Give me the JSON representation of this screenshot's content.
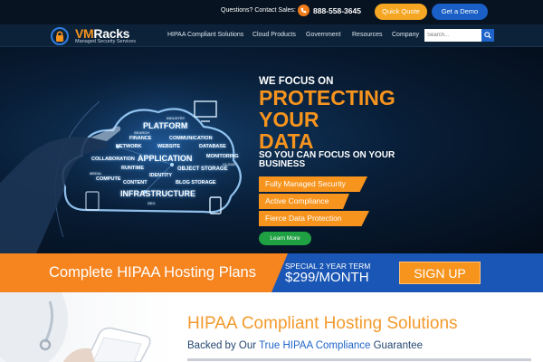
{
  "topbar": {
    "contact_label": "Questions? Contact Sales:",
    "phone": "888-558-3645",
    "quote_button": "Quick Quote",
    "demo_button": "Get a Demo"
  },
  "nav": {
    "logo_brand_vm": "VM",
    "logo_brand_racks": "Racks",
    "logo_tagline": "Managed Security Services",
    "items": [
      "HIPAA Compliant Solutions",
      "Cloud Products",
      "Government",
      "Resources",
      "Company"
    ],
    "search_placeholder": "Search..."
  },
  "hero": {
    "pre_title": "WE FOCUS ON",
    "headline_lines": [
      "PROTECTING",
      "YOUR",
      "DATA"
    ],
    "subtitle": "SO YOU CAN FOCUS ON YOUR BUSINESS",
    "features": [
      "Fully Managed Security",
      "Active Compliance",
      "Fierce Data Protection"
    ],
    "learn_more": "Learn More",
    "cloud_words": [
      "PLATFORM",
      "FINANCE",
      "COMMUNICATION",
      "NETWORK",
      "WEBSITE",
      "DATABASE",
      "APPLICATION",
      "MONITORING",
      "COLLABORATION",
      "RUNTIME",
      "OBJECT STORAGE",
      "IDENTITY",
      "COMPUTE",
      "CONTENT",
      "BLOG STORAGE",
      "INFRASTRUCTURE",
      "INDUSTRY",
      "SEARCH",
      "MEDIA",
      "CLOUD",
      "SEO"
    ]
  },
  "plans": {
    "title": "Complete HIPAA Hosting Plans",
    "special": "SPECIAL 2 YEAR TERM",
    "price": "$299/MONTH",
    "signup": "SIGN UP"
  },
  "lower": {
    "heading": "HIPAA Compliant Hosting Solutions",
    "sub_prefix": "Backed by Our ",
    "sub_highlight": "True HIPAA Compliance",
    "sub_suffix": " Guarantee"
  },
  "colors": {
    "orange": "#f7941d",
    "blue": "#1956b5",
    "green": "#1fa043",
    "navy": "#0c2238"
  }
}
